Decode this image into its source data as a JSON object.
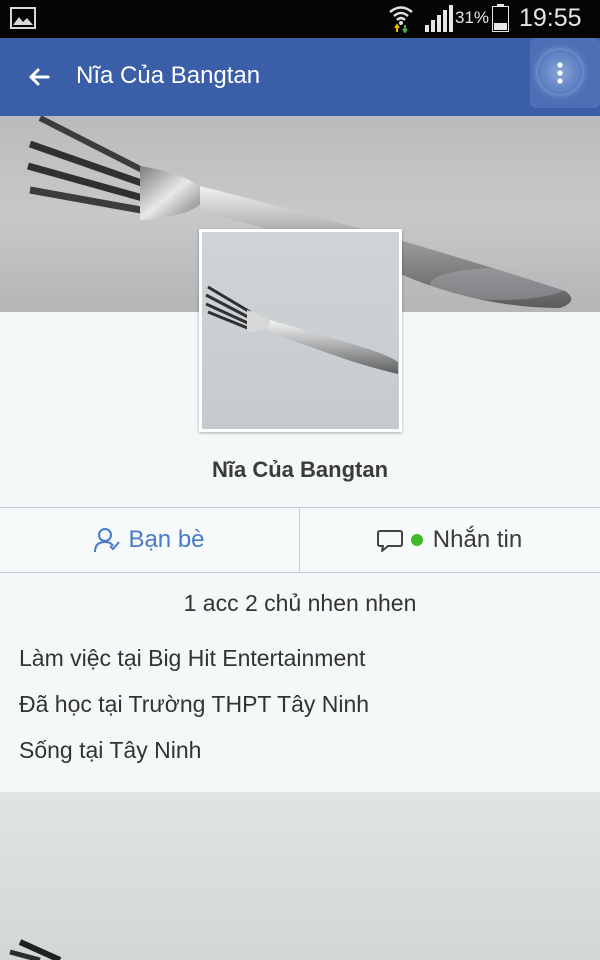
{
  "status_bar": {
    "battery_percent": "31%",
    "time": "19:55",
    "icons": [
      "gallery-icon",
      "wifi-icon",
      "signal-icon",
      "battery-icon"
    ]
  },
  "app_bar": {
    "title": "Nĩa Của Bangtan",
    "background": "#3b5ea9",
    "icons": [
      "back-arrow-icon",
      "overflow-menu-icon"
    ]
  },
  "profile": {
    "name": "Nĩa Của Bangtan",
    "cover_photo": "fork-photo",
    "profile_photo": "fork-photo"
  },
  "actions": {
    "friends_label": "Bạn bè",
    "message_label": "Nhắn tin",
    "accent": "#4a7ac8",
    "online_color": "#42b72a"
  },
  "info": {
    "bio": "1 acc 2 chủ nhen nhen",
    "work": "Làm việc tại Big Hit Entertainment",
    "education": "Đã học tại Trường THPT Tây Ninh",
    "lives": "Sống tại Tây Ninh"
  }
}
